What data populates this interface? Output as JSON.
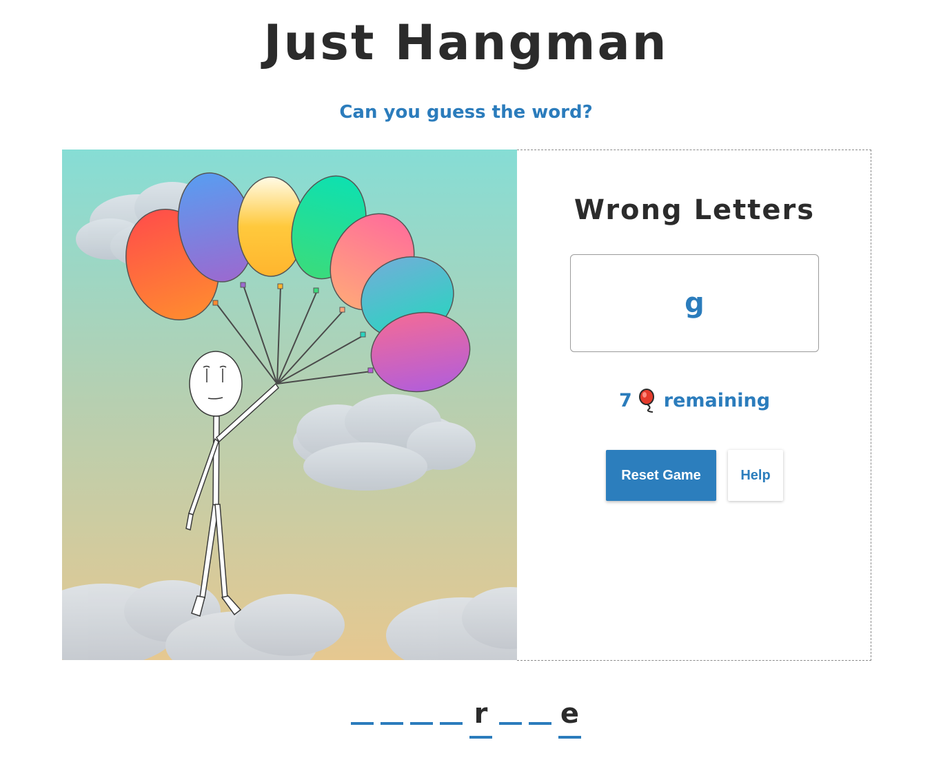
{
  "header": {
    "title": "Just Hangman",
    "subtitle": "Can you guess the word?"
  },
  "panel": {
    "title": "Wrong Letters",
    "wrong_letters": "g",
    "remaining_count": "7",
    "remaining_label": "remaining",
    "balloon_icon": "balloon-icon"
  },
  "buttons": {
    "reset": "Reset Game",
    "help": "Help"
  },
  "word": {
    "slots": [
      "",
      "",
      "",
      "",
      "r",
      "",
      "",
      "e"
    ]
  },
  "scene": {
    "balloons_remaining": 7,
    "balloon_colors": [
      "#ff5a3c",
      "#5a96f0",
      "#ffd24a",
      "#12e0a0",
      "#ff7a90",
      "#5ab4d8",
      "#e06cc0"
    ],
    "sky_top": "#86ddd5",
    "sky_bottom": "#e6c890"
  },
  "colors": {
    "accent": "#2c7ebd",
    "text_dark": "#2b2b2b"
  }
}
